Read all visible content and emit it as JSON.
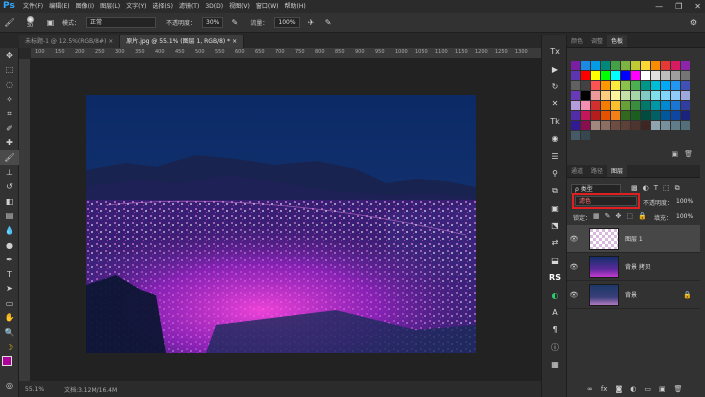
{
  "app": {
    "logo": "Ps"
  },
  "menu": [
    "文件(F)",
    "编辑(E)",
    "图像(I)",
    "图层(L)",
    "文字(Y)",
    "选择(S)",
    "滤镜(T)",
    "3D(D)",
    "视图(V)",
    "窗口(W)",
    "帮助(H)"
  ],
  "window_buttons": {
    "minimize": "—",
    "maximize": "❐",
    "close": "✕"
  },
  "options": {
    "brush_size": "30",
    "mode_label": "模式：",
    "mode_value": "正常",
    "opacity_label": "不透明度：",
    "opacity_value": "30%",
    "flow_label": "流量：",
    "flow_value": "100%"
  },
  "tabs": [
    {
      "label": "未标题-1 @ 12.5%(RGB/8#) ×"
    },
    {
      "label": "原片.jpg @ 55.1% (图层 1, RGB/8) * ×"
    }
  ],
  "ruler_ticks": [
    "100",
    "150",
    "200",
    "250",
    "300",
    "350",
    "400",
    "450",
    "500",
    "550",
    "600",
    "650",
    "700",
    "750",
    "800",
    "850",
    "900",
    "950",
    "1000",
    "1050",
    "1100",
    "1150",
    "1200",
    "1250",
    "1300"
  ],
  "status": {
    "zoom": "55.1%",
    "doc": "文档:3.12M/16.4M"
  },
  "swatches_panel": {
    "tabs": [
      "颜色",
      "调整",
      "色板"
    ],
    "colors": [
      "#7b1fa2",
      "#1e88e5",
      "#039be5",
      "#00897b",
      "#43a047",
      "#7cb342",
      "#c0ca33",
      "#fdd835",
      "#fb8c00",
      "#e53935",
      "#d81b60",
      "#8e24aa",
      "#5e35b1",
      "#ff0000",
      "#ffff00",
      "#00ff00",
      "#00ffff",
      "#0000ff",
      "#ff00ff",
      "#ffffff",
      "#e0e0e0",
      "#bdbdbd",
      "#9e9e9e",
      "#757575",
      "#616161",
      "#424242",
      "#ff5252",
      "#ff9800",
      "#ffeb3b",
      "#8bc34a",
      "#4caf50",
      "#009688",
      "#00bcd4",
      "#03a9f4",
      "#2196f3",
      "#3f51b5",
      "#673ab7",
      "#000000",
      "#ef9a9a",
      "#ffcc80",
      "#fff59d",
      "#c5e1a5",
      "#a5d6a7",
      "#80cbc4",
      "#80deea",
      "#81d4fa",
      "#90caf9",
      "#9fa8da",
      "#b39ddb",
      "#f48fb1",
      "#d32f2f",
      "#f57c00",
      "#fbc02d",
      "#689f38",
      "#388e3c",
      "#00796b",
      "#0097a7",
      "#0288d1",
      "#1976d2",
      "#303f9f",
      "#512da8",
      "#c2185b",
      "#b71c1c",
      "#e65100",
      "#f57f17",
      "#33691e",
      "#1b5e20",
      "#004d40",
      "#006064",
      "#01579b",
      "#0d47a1",
      "#1a237e",
      "#311b92",
      "#880e4f",
      "#a1887f",
      "#8d6e63",
      "#6d4c41",
      "#5d4037",
      "#4e342e",
      "#3e2723",
      "#90a4ae",
      "#78909c",
      "#607d8b",
      "#546e7a",
      "#455a64",
      "#37474f"
    ]
  },
  "layers_panel": {
    "tabs": [
      "通道",
      "路径",
      "图层"
    ],
    "kind": "ρ 类型",
    "blend_mode": "滤色",
    "opacity_label": "不透明度：",
    "opacity_value": "100%",
    "lock_label": "锁定：",
    "fill_label": "填充：",
    "fill_value": "100%",
    "layers": [
      {
        "name": "图层 1"
      },
      {
        "name": "背景 拷贝"
      },
      {
        "name": "背景"
      }
    ]
  }
}
